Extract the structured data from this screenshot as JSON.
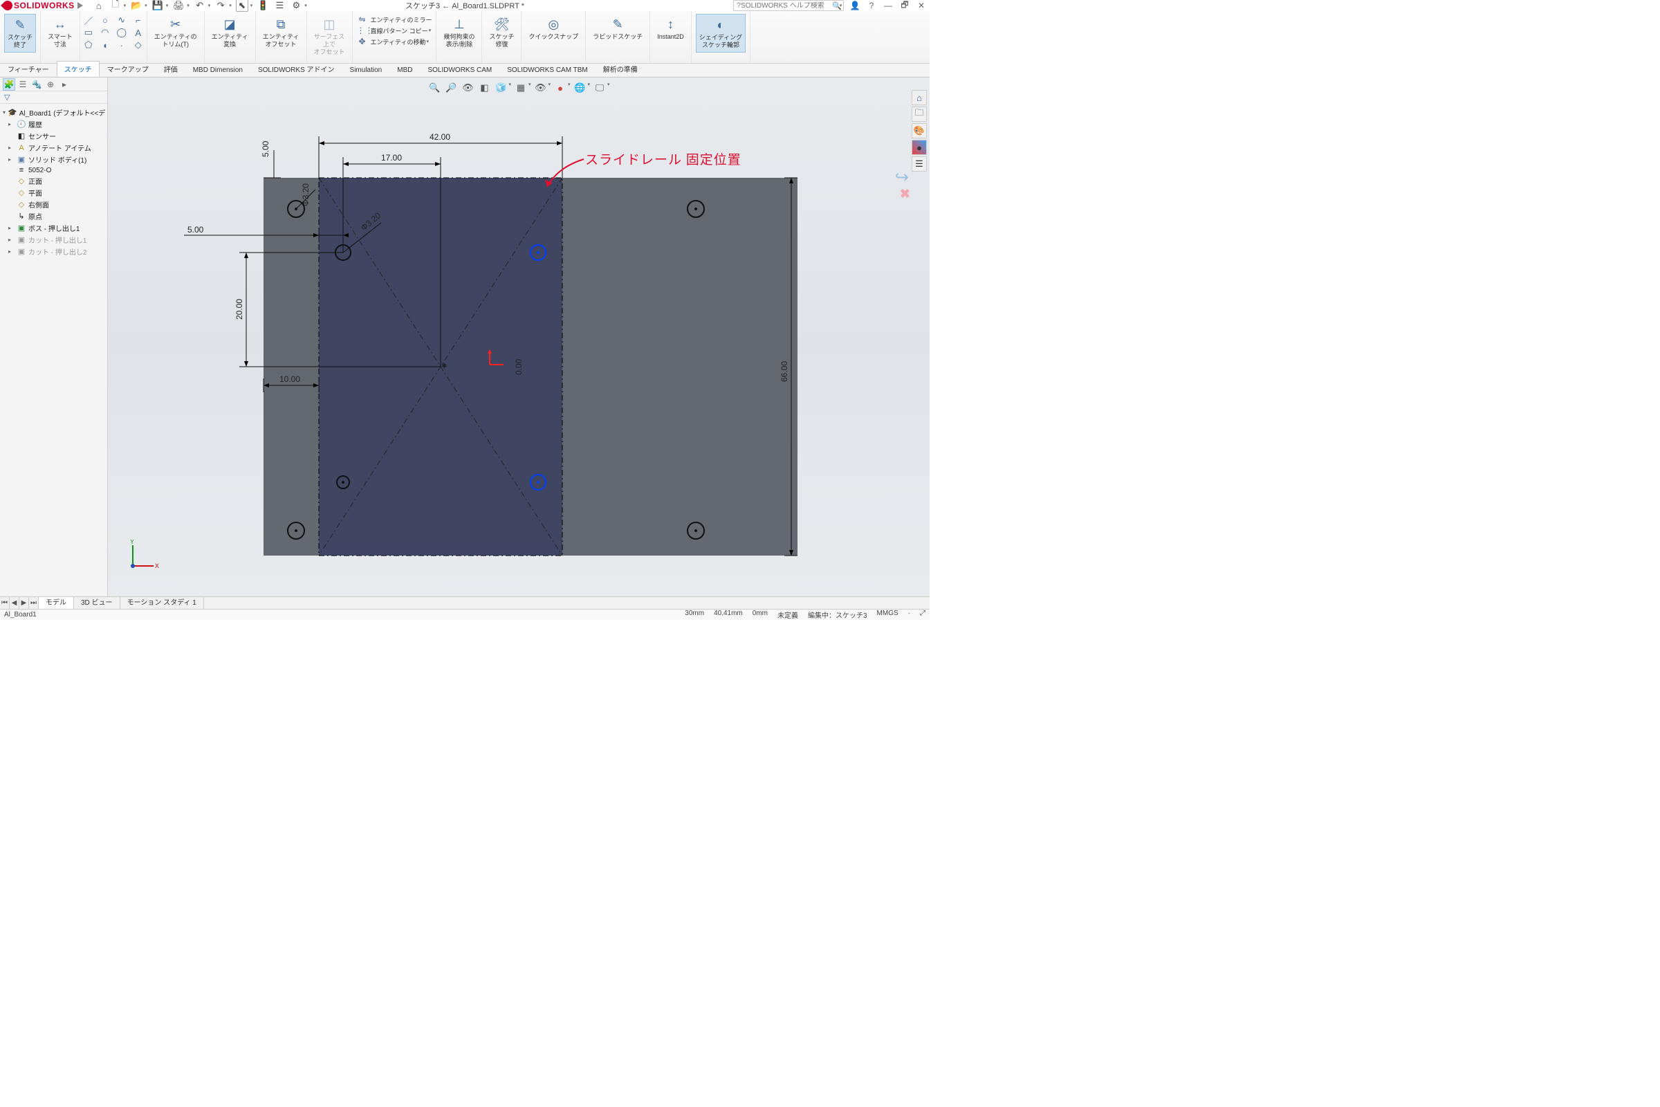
{
  "app": {
    "name": "SOLIDWORKS",
    "doc_title": "スケッチ3 ← Al_Board1.SLDPRT *",
    "search_placeholder": "SOLIDWORKS ヘルプ検索"
  },
  "ribbon": {
    "exit_sketch": "スケッチ\n終了",
    "smart_dim": "スマート\n寸法",
    "trim": "エンティティの\nトリム(T)",
    "convert": "エンティティ\n変換",
    "offset": "エンティティ\nオフセット",
    "surf_offset": "サーフェス\n上で\nオフセット",
    "mirror": "エンティティのミラー",
    "linear": "直線パターン コピー",
    "move": "エンティティの移動",
    "geo_rel": "幾何拘束の\n表示/削除",
    "repair": "スケッチ\n修復",
    "quick": "クイックスナップ",
    "rapid": "ラピッドスケッチ",
    "instant": "Instant2D",
    "shaded": "シェイディング\nスケッチ輪郭"
  },
  "cmtabs": [
    "フィーチャー",
    "スケッチ",
    "マークアップ",
    "評価",
    "MBD Dimension",
    "SOLIDWORKS アドイン",
    "Simulation",
    "MBD",
    "SOLIDWORKS CAM",
    "SOLIDWORKS CAM TBM",
    "解析の準備"
  ],
  "tree": {
    "root": "Al_Board1 (デフォルト<<デ",
    "items": [
      {
        "t": "履歴",
        "i": "🕘",
        "exp": "▸"
      },
      {
        "t": "センサー",
        "i": "◧",
        "exp": ""
      },
      {
        "t": "アノテート アイテム",
        "i": "A",
        "exp": "▸"
      },
      {
        "t": "ソリッド ボディ(1)",
        "i": "▣",
        "exp": "▸"
      },
      {
        "t": "5052-O",
        "i": "≡",
        "exp": ""
      },
      {
        "t": "正面",
        "i": "◇",
        "exp": ""
      },
      {
        "t": "平面",
        "i": "◇",
        "exp": ""
      },
      {
        "t": "右側面",
        "i": "◇",
        "exp": ""
      },
      {
        "t": "原点",
        "i": "↳",
        "exp": ""
      },
      {
        "t": "ボス - 押し出し1",
        "i": "▣",
        "exp": "▸",
        "c": "#2a8a3a"
      },
      {
        "t": "カット - 押し出し1",
        "i": "▣",
        "exp": "▸",
        "c": "#999"
      },
      {
        "t": "カット - 押し出し2",
        "i": "▣",
        "exp": "▸",
        "c": "#999"
      }
    ]
  },
  "dims": {
    "d42": "42.00",
    "d17": "17.00",
    "d5v": "5.00",
    "d5h": "5.00",
    "d10": "10.00",
    "d20": "20.00",
    "d66": "66.00",
    "d0": "0.00",
    "phi1": "Φ3.20",
    "phi2": "Φ3.20"
  },
  "annotation": "スライドレール 固定位置",
  "btabs": [
    "モデル",
    "3D ビュー",
    "モーション スタディ 1"
  ],
  "status": {
    "file": "Al_Board1",
    "m1": "30mm",
    "m2": "40.41mm",
    "m3": "0mm",
    "und": "未定義",
    "edit": "編集中：スケッチ3",
    "units": "MMGS"
  }
}
